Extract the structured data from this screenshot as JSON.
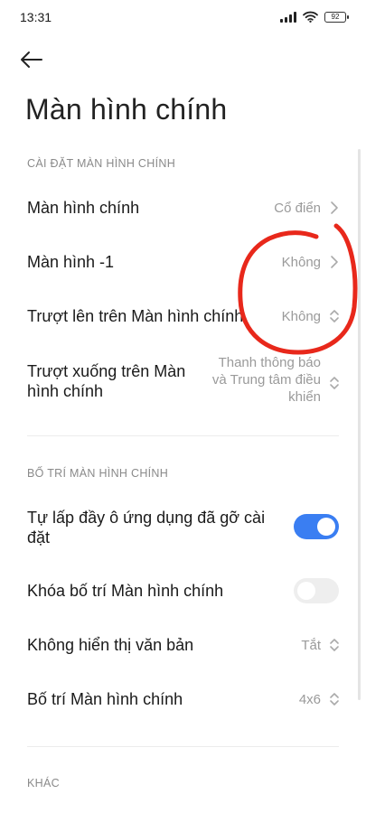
{
  "status_bar": {
    "time": "13:31",
    "battery": "92",
    "icons": [
      "signal-icon",
      "wifi-icon",
      "battery-icon"
    ]
  },
  "header": {
    "back_icon": "arrow-left-icon",
    "title": "Màn hình chính"
  },
  "sections": {
    "home_settings": {
      "header": "CÀI ĐẶT MÀN HÌNH CHÍNH",
      "rows": [
        {
          "label": "Màn hình chính",
          "value": "Cổ điển",
          "control": "chevron-right-icon"
        },
        {
          "label": "Màn hình -1",
          "value": "Không",
          "control": "chevron-right-icon"
        },
        {
          "label": "Trượt lên trên Màn hình chính",
          "value": "Không",
          "control": "chevron-updown-icon"
        },
        {
          "label_line1": "Trượt xuống trên Màn",
          "label_line2": "hình chính",
          "value_line1": "Thanh thông báo",
          "value_line2": "và Trung tâm điều",
          "value_line3": "khiển",
          "control": "chevron-updown-icon"
        }
      ]
    },
    "layout": {
      "header": "BỐ TRÍ MÀN HÌNH CHÍNH",
      "rows": [
        {
          "label_line1": "Tự lấp đầy ô ứng dụng đã gỡ cài",
          "label_line2": "đặt",
          "toggle_on": true
        },
        {
          "label": "Khóa bố trí Màn hình chính",
          "toggle_on": false
        },
        {
          "label": "Không hiển thị văn bản",
          "value": "Tắt",
          "control": "chevron-updown-icon"
        },
        {
          "label": "Bố trí Màn hình chính",
          "value": "4x6",
          "control": "chevron-updown-icon"
        }
      ]
    },
    "other": {
      "header": "KHÁC"
    }
  },
  "colors": {
    "accent": "#3a7ef2",
    "annotation": "#e8281b",
    "secondary_text": "#9a9a9a"
  }
}
